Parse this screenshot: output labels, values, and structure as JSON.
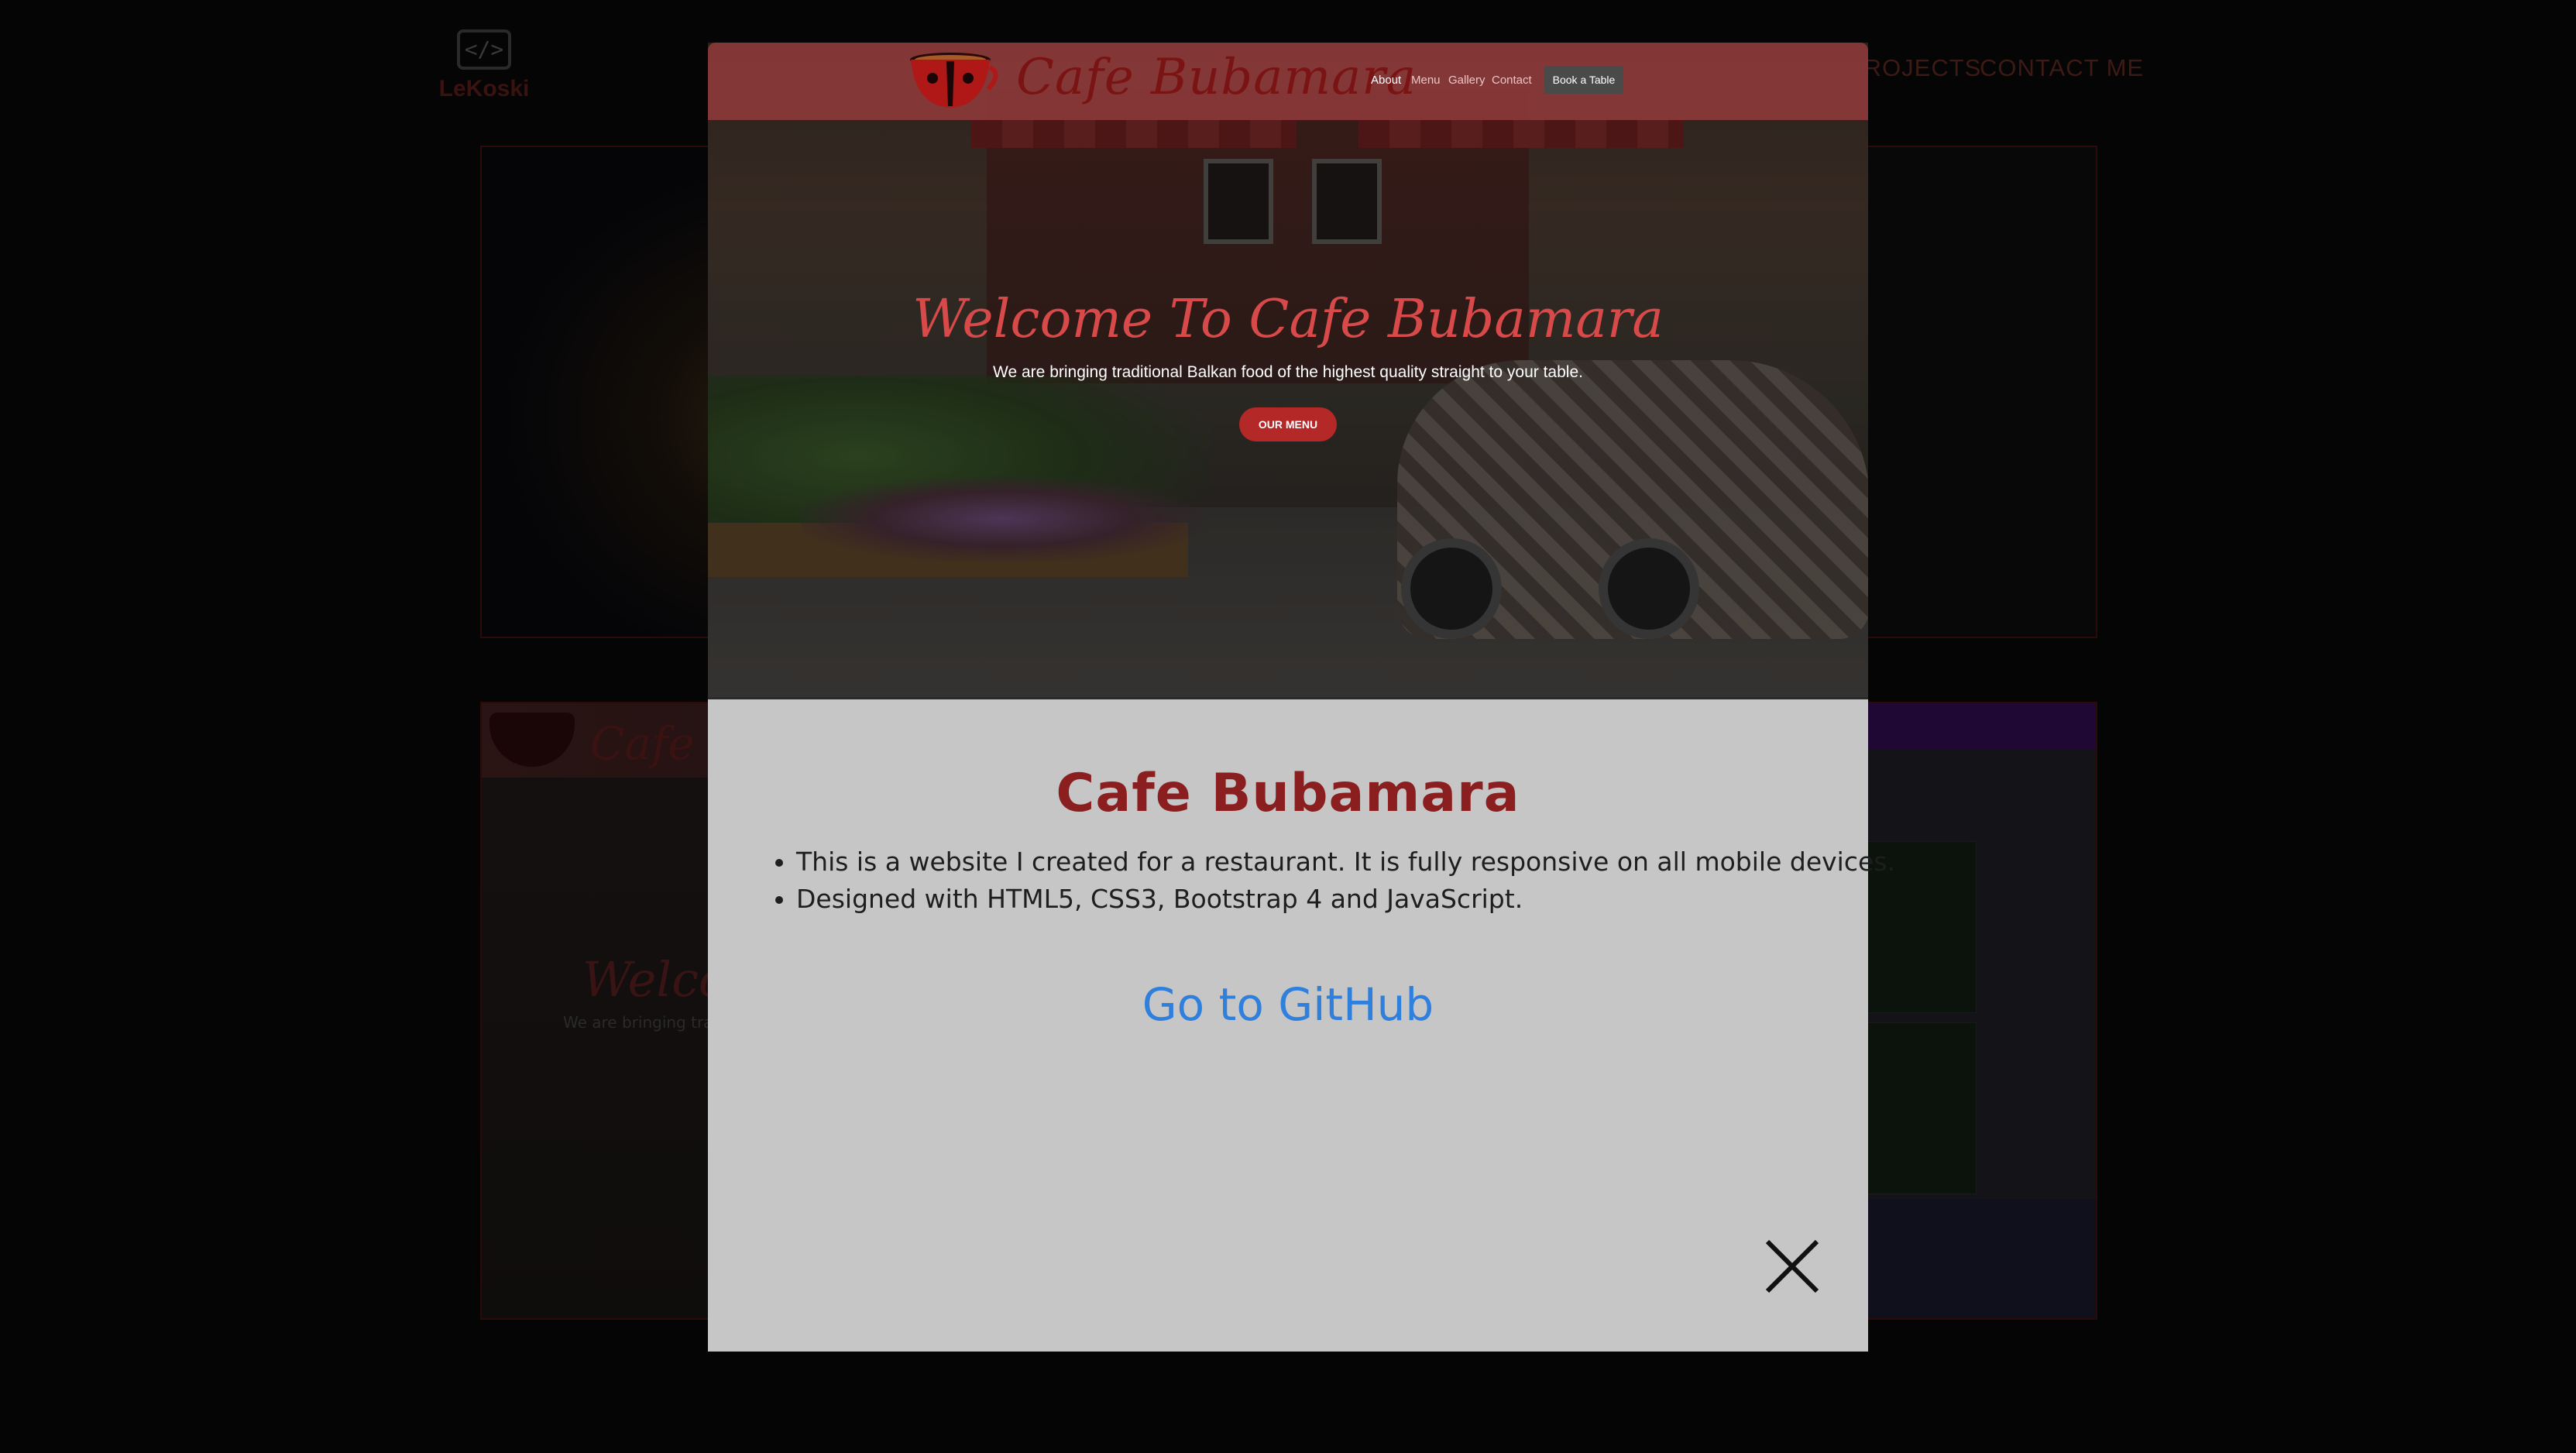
{
  "background": {
    "logo_text": "LeKoski",
    "logo_icon": "code-brackets-icon",
    "nav": [
      "PROJECTS",
      "CONTACT ME"
    ]
  },
  "modal": {
    "screenshot": {
      "brand": "Cafe Bubamara",
      "nav_links": [
        "About",
        "Menu",
        "Gallery",
        "Contact"
      ],
      "book_button": "Book a Table",
      "welcome": "Welcome To Cafe Bubamara",
      "tagline": "We are bringing traditional Balkan food of the highest quality straight to your table.",
      "menu_button": "OUR MENU"
    },
    "title": "Cafe Bubamara",
    "bullets": [
      "This is a website I created for a restaurant. It is fully responsive on all mobile devices.",
      "Designed with HTML5, CSS3, Bootstrap 4 and JavaScript."
    ],
    "link_text": "Go to GitHub",
    "close_icon": "close-icon"
  },
  "colors": {
    "title": "#8b1f1f",
    "link": "#2f7fdc",
    "modal_bg": "#c6c6c6",
    "brand_red": "#b52828"
  }
}
